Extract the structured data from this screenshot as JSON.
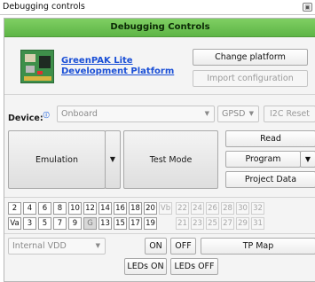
{
  "window": {
    "title": "Debugging controls",
    "icon": "window-restore-icon"
  },
  "header": {
    "title": "Debugging Controls",
    "color": "#6cc253"
  },
  "platform": {
    "link_text": "GreenPAK Lite Development Platform",
    "image_icon": "dev-board-icon"
  },
  "buttons": {
    "change_platform": "Change platform",
    "import_configuration": "Import configuration",
    "emulation": "Emulation",
    "test_mode": "Test Mode",
    "read": "Read",
    "program": "Program",
    "project_data": "Project Data",
    "i2c_reset": "I2C Reset",
    "on": "ON",
    "off": "OFF",
    "leds_on": "LEDs ON",
    "leds_off": "LEDs OFF",
    "tp_map": "TP Map"
  },
  "device": {
    "label": "Device:",
    "value": "Onboard",
    "mode": "GPSD"
  },
  "power": {
    "value": "Internal VDD"
  },
  "pins": {
    "row1": [
      "2",
      "4",
      "6",
      "8",
      "10",
      "12",
      "14",
      "16",
      "18",
      "20",
      "Vb",
      "22",
      "24",
      "26",
      "28",
      "30",
      "32"
    ],
    "row2": [
      "Va",
      "3",
      "5",
      "7",
      "9",
      "G",
      "13",
      "15",
      "17",
      "19",
      "",
      "21",
      "23",
      "25",
      "27",
      "29",
      "31"
    ]
  }
}
